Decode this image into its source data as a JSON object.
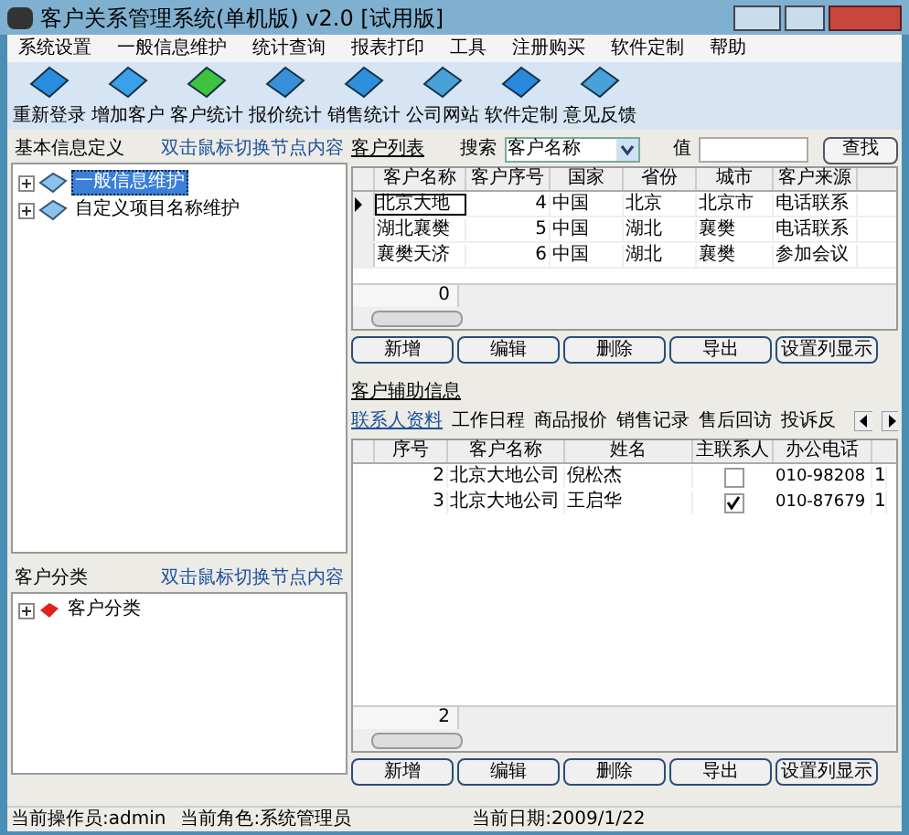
{
  "window": {
    "title": "客户关系管理系统(单机版) v2.0 [试用版]"
  },
  "menu": [
    "系统设置",
    "一般信息维护",
    "统计查询",
    "报表打印",
    "工具",
    "注册购买",
    "软件定制",
    "帮助"
  ],
  "toolbar": [
    {
      "label": "重新登录",
      "kind": "blue"
    },
    {
      "label": "增加客户",
      "kind": "folder"
    },
    {
      "label": "客户统计",
      "kind": "green"
    },
    {
      "label": "报价统计",
      "kind": "pen"
    },
    {
      "label": "销售统计",
      "kind": "box"
    },
    {
      "label": "公司网站",
      "kind": "screen"
    },
    {
      "label": "软件定制",
      "kind": "save"
    },
    {
      "label": "意见反馈",
      "kind": "mail"
    }
  ],
  "basic_info": {
    "title": "基本信息定义",
    "hint": "双击鼠标切换节点内容",
    "tree": [
      {
        "label": "一般信息维护",
        "selected": true
      },
      {
        "label": "自定义项目名称维护",
        "selected": false
      }
    ]
  },
  "customer_category": {
    "title": "客户分类",
    "hint": "双击鼠标切换节点内容",
    "tree": [
      {
        "label": "客户分类",
        "selected": false
      }
    ]
  },
  "customer_list": {
    "title": "客户列表",
    "search_label": "搜索",
    "search_field": "客户名称",
    "value_label": "值",
    "find_button": "查找",
    "columns": [
      "客户名称",
      "客户序号",
      "国家",
      "省份",
      "城市",
      "客户来源"
    ],
    "rows": [
      {
        "cells": [
          "北京大地",
          "4",
          "中国",
          "北京",
          "北京市",
          "电话联系"
        ],
        "selected": true
      },
      {
        "cells": [
          "湖北襄樊",
          "5",
          "中国",
          "湖北",
          "襄樊",
          "电话联系"
        ],
        "selected": false
      },
      {
        "cells": [
          "襄樊天济",
          "6",
          "中国",
          "湖北",
          "襄樊",
          "参加会议"
        ],
        "selected": false
      }
    ],
    "footer": "0",
    "buttons": [
      "新增",
      "编辑",
      "删除",
      "导出",
      "设置列显示"
    ]
  },
  "aux_info": {
    "title": "客户辅助信息",
    "tabs": [
      {
        "label": "联系人资料",
        "selected": true
      },
      {
        "label": "工作日程",
        "selected": false
      },
      {
        "label": "商品报价",
        "selected": false
      },
      {
        "label": "销售记录",
        "selected": false
      },
      {
        "label": "售后回访",
        "selected": false
      },
      {
        "label": "投诉反",
        "selected": false
      }
    ],
    "columns": [
      "序号",
      "客户名称",
      "姓名",
      "主联系人",
      "办公电话"
    ],
    "rows": [
      {
        "cells": [
          "2",
          "北京大地公司",
          "倪松杰",
          "010-98208"
        ],
        "main_contact": false,
        "extra": "1"
      },
      {
        "cells": [
          "3",
          "北京大地公司",
          "王启华",
          "010-87679"
        ],
        "main_contact": true,
        "extra": "1"
      }
    ],
    "footer": "2",
    "buttons": [
      "新增",
      "编辑",
      "删除",
      "导出",
      "设置列显示"
    ]
  },
  "status_bar": [
    "当前操作员:admin",
    "当前角色:系统管理员",
    "当前日期:2009/1/22"
  ]
}
